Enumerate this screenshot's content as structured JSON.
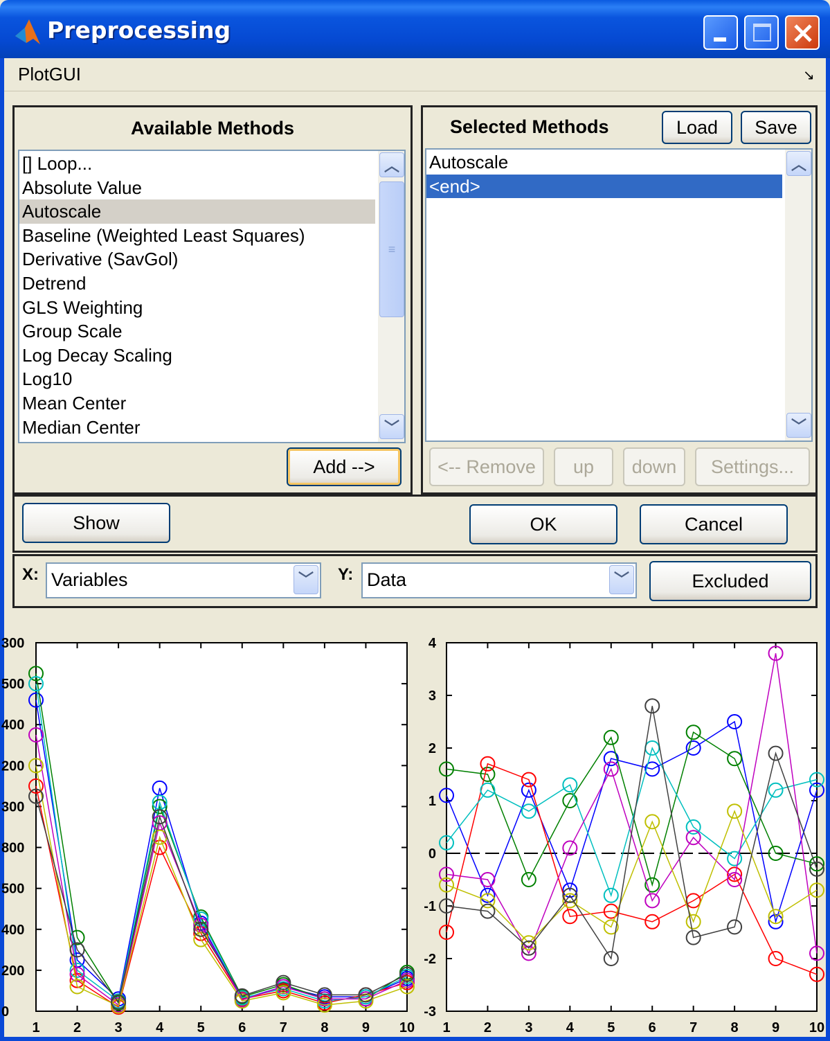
{
  "window": {
    "title": "Preprocessing"
  },
  "menu": {
    "items": [
      "PlotGUI"
    ],
    "corner_glyph": "↘"
  },
  "available": {
    "title": "Available Methods",
    "items": [
      "[] Loop...",
      "Absolute Value",
      "Autoscale",
      "Baseline (Weighted Least Squares)",
      "Derivative (SavGol)",
      "Detrend",
      "GLS Weighting",
      "Group Scale",
      "Log Decay Scaling",
      "Log10",
      "Mean Center",
      "Median Center"
    ],
    "highlighted_index": 2,
    "add_label": "Add -->"
  },
  "selected": {
    "title": "Selected Methods",
    "load_label": "Load",
    "save_label": "Save",
    "items": [
      "Autoscale",
      "<end>"
    ],
    "selected_index": 1,
    "remove_label": "<-- Remove",
    "up_label": "up",
    "down_label": "down",
    "settings_label": "Settings..."
  },
  "actions": {
    "show_label": "Show",
    "ok_label": "OK",
    "cancel_label": "Cancel"
  },
  "plot_controls": {
    "x_label": "X:",
    "x_value": "Variables",
    "y_label": "Y:",
    "y_value": "Data",
    "excluded_label": "Excluded"
  },
  "chart_data": [
    {
      "type": "line",
      "title": "",
      "xlabel": "",
      "ylabel": "",
      "x": [
        1,
        2,
        3,
        4,
        5,
        6,
        7,
        8,
        9,
        10
      ],
      "xlim": [
        1,
        10
      ],
      "ylim": [
        0,
        1800
      ],
      "yticks": [
        0,
        200,
        400,
        600,
        800,
        1000,
        1200,
        1400,
        1600,
        1800
      ],
      "ytick_labels": [
        "0",
        "200",
        "400",
        "500",
        "800",
        "300",
        "200",
        "400",
        "500",
        "300"
      ],
      "markers": "circle",
      "series": [
        {
          "color": "#0000ff",
          "values": [
            1520,
            250,
            60,
            1090,
            430,
            60,
            120,
            70,
            70,
            160
          ]
        },
        {
          "color": "#008000",
          "values": [
            1650,
            360,
            40,
            1000,
            460,
            70,
            130,
            60,
            60,
            190
          ]
        },
        {
          "color": "#ff0000",
          "values": [
            1100,
            150,
            20,
            800,
            380,
            60,
            100,
            40,
            80,
            140
          ]
        },
        {
          "color": "#00bfbf",
          "values": [
            1600,
            200,
            50,
            1020,
            450,
            65,
            110,
            50,
            70,
            170
          ]
        },
        {
          "color": "#bf00bf",
          "values": [
            1350,
            180,
            30,
            920,
            420,
            55,
            120,
            60,
            60,
            150
          ]
        },
        {
          "color": "#bfbf00",
          "values": [
            1200,
            120,
            25,
            850,
            350,
            50,
            90,
            30,
            50,
            120
          ]
        },
        {
          "color": "#404040",
          "values": [
            1050,
            300,
            45,
            950,
            400,
            75,
            140,
            80,
            80,
            180
          ]
        }
      ]
    },
    {
      "type": "line",
      "title": "",
      "xlabel": "",
      "ylabel": "",
      "x": [
        1,
        2,
        3,
        4,
        5,
        6,
        7,
        8,
        9,
        10
      ],
      "xlim": [
        1,
        10
      ],
      "ylim": [
        -3,
        4
      ],
      "yticks": [
        -3,
        -2,
        -1,
        0,
        1,
        2,
        3,
        4
      ],
      "markers": "circle",
      "series": [
        {
          "color": "#0000ff",
          "values": [
            1.1,
            -0.8,
            1.2,
            -0.7,
            1.8,
            1.6,
            2.0,
            2.5,
            -1.3,
            1.2
          ]
        },
        {
          "color": "#008000",
          "values": [
            1.6,
            1.5,
            -0.5,
            1.0,
            2.2,
            -0.6,
            2.3,
            1.8,
            0.0,
            -0.2
          ]
        },
        {
          "color": "#ff0000",
          "values": [
            -1.5,
            1.7,
            1.4,
            -1.2,
            -1.1,
            -1.3,
            -0.9,
            -0.4,
            -2.0,
            -2.3
          ]
        },
        {
          "color": "#00bfbf",
          "values": [
            0.2,
            1.2,
            0.8,
            1.3,
            -0.8,
            2.0,
            0.5,
            -0.1,
            1.2,
            1.4
          ]
        },
        {
          "color": "#bf00bf",
          "values": [
            -0.4,
            -0.5,
            -1.9,
            0.1,
            1.6,
            -0.9,
            0.3,
            -0.5,
            3.8,
            -1.9
          ]
        },
        {
          "color": "#bfbf00",
          "values": [
            -0.6,
            -0.9,
            -1.7,
            -0.9,
            -1.4,
            0.6,
            -1.3,
            0.8,
            -1.2,
            -0.7
          ]
        },
        {
          "color": "#404040",
          "values": [
            -1.0,
            -1.1,
            -1.8,
            -0.8,
            -2.0,
            2.8,
            -1.6,
            -1.4,
            1.9,
            -0.3
          ]
        }
      ]
    }
  ]
}
